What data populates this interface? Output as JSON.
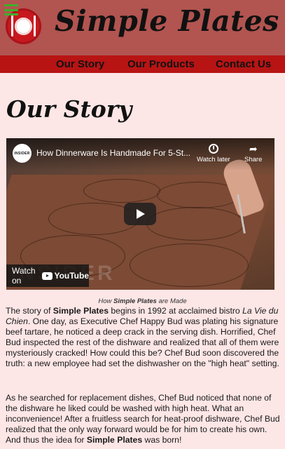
{
  "header": {
    "brand_name": "Simple Plates",
    "menu_icon": "hamburger-menu-icon",
    "logo_icon": "plate-fork-knife-logo",
    "colors": {
      "header_bg": "#b25450",
      "nav_bg": "#b81414",
      "page_bg": "#fde6e6",
      "menu_icon": "#3fae2a"
    }
  },
  "nav": {
    "items": [
      {
        "label": "Our Story"
      },
      {
        "label": "Our Products"
      },
      {
        "label": "Contact Us"
      }
    ]
  },
  "main": {
    "page_title": "Our Story",
    "video": {
      "channel": "INSIDER",
      "title": "How Dinnerware Is Handmade For 5-St...",
      "watch_later": "Watch later",
      "share": "Share",
      "watch_on": "Watch on",
      "youtube": "YouTube",
      "watermark": "INSIDER"
    },
    "caption": {
      "prefix": "How ",
      "brand": "Simple Plates",
      "suffix": " are Made"
    },
    "paragraph1": {
      "t1": "The story of ",
      "brand": "Simple Plates",
      "t2": " begins in 1992 at acclaimed bistro ",
      "bistro": "La Vie du Chien",
      "t3": ". One day, as Executive Chef Happy Bud was plating his signature beef tartare, he noticed a deep crack in the serving dish. Horrified, Chef Bud inspected the rest of the dishware and realized that all of them were mysteriously cracked! How could this be? Chef Bud soon discovered the truth: a new employee had set the dishwasher on the \"high heat\" setting."
    },
    "paragraph2": {
      "t1": "As he searched for replacement dishes, Chef Bud noticed that none of the dishware he liked could be washed with high heat. What an inconvenience! After a fruitless search for heat-proof dishware, Chef Bud realized that the only way forward would be for him to create his own. And thus the idea for ",
      "brand": "Simple Plates",
      "t2": " was born!"
    }
  }
}
